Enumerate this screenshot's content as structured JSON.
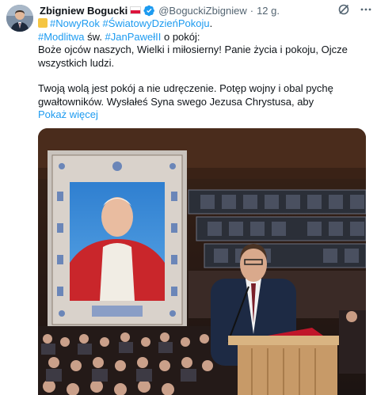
{
  "author": {
    "name": "Zbigniew Bogucki",
    "handle": "@BoguckiZbigniew",
    "separator": "·",
    "time": "12 g."
  },
  "icons": {
    "avatar": "avatar-portrait",
    "flag": "poland-flag-icon",
    "verified": "verified-badge-icon",
    "grok": "grok-icon",
    "more": "more-options-icon",
    "emoji": "yellow-square-emoji"
  },
  "text": {
    "line1_hashtags": "#NowyRok #ŚwiatowyDzieńPokoju",
    "line1_end": ".",
    "line2_tag1": "#Modlitwa",
    "line2_mid": " św. ",
    "line2_tag2": "#JanPawełII",
    "line2_end": " o pokój:",
    "line3": "Boże ojców naszych, Wielki i miłosierny! Panie życia i pokoju, Ojcze",
    "line4": "wszystkich ludzi.",
    "line5": "Twoją wolą jest pokój a nie udręczenie. Potęp wojny i obal pychę",
    "line6": "gwałtowników. Wysłałeś Syna swego Jezusa Chrystusa, aby",
    "show_more": "Pokaż więcej"
  },
  "colors": {
    "link": "#1d9bf0",
    "secondary": "#536471",
    "text": "#0f1419"
  }
}
